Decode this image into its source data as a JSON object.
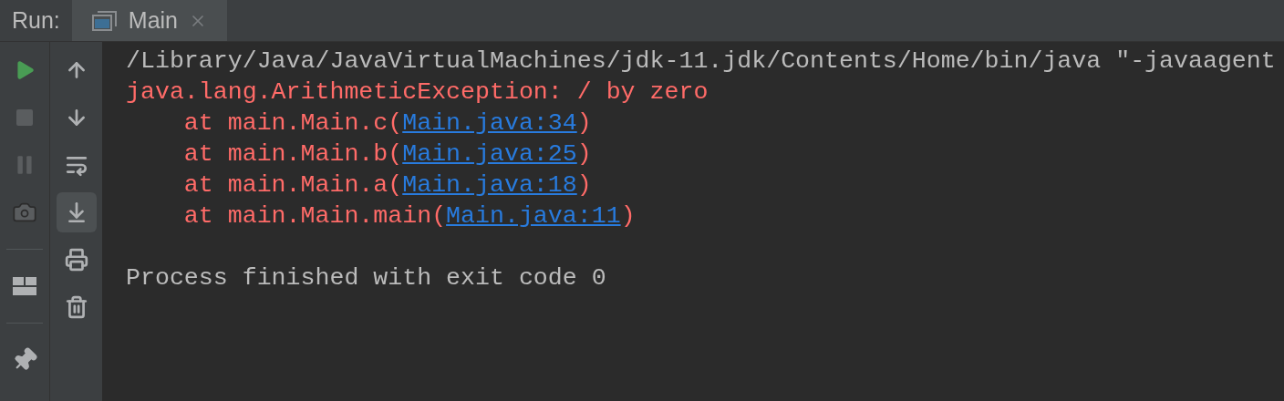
{
  "run_label": "Run:",
  "tabs": [
    {
      "label": "Main",
      "selected": true,
      "closable": true
    }
  ],
  "toolbar_left": [
    {
      "kind": "run",
      "disabled": false
    },
    {
      "kind": "stop",
      "disabled": true
    },
    {
      "kind": "pause",
      "disabled": true
    },
    {
      "kind": "camera",
      "disabled": true
    },
    {
      "kind": "separator"
    },
    {
      "kind": "layout",
      "disabled": false
    },
    {
      "kind": "separator"
    },
    {
      "kind": "pin",
      "disabled": false
    }
  ],
  "toolbar_right": [
    {
      "kind": "up",
      "selected": false
    },
    {
      "kind": "down",
      "selected": false
    },
    {
      "kind": "wrap",
      "selected": false
    },
    {
      "kind": "scroll-end",
      "selected": true
    },
    {
      "kind": "print",
      "selected": false
    },
    {
      "kind": "delete",
      "selected": false
    }
  ],
  "console": [
    {
      "kind": "command",
      "parts": [
        {
          "text": "/Library/Java/JavaVirtualMachines/jdk-11.jdk/Contents/Home/bin/java \"-javaagent",
          "link": false
        }
      ]
    },
    {
      "kind": "error",
      "parts": [
        {
          "text": "java.lang.ArithmeticException: / by zero",
          "link": false
        }
      ]
    },
    {
      "kind": "error",
      "parts": [
        {
          "text": "    at main.Main.c(",
          "link": false
        },
        {
          "text": "Main.java:34",
          "link": true
        },
        {
          "text": ")",
          "link": false
        }
      ]
    },
    {
      "kind": "error",
      "parts": [
        {
          "text": "    at main.Main.b(",
          "link": false
        },
        {
          "text": "Main.java:25",
          "link": true
        },
        {
          "text": ")",
          "link": false
        }
      ]
    },
    {
      "kind": "error",
      "parts": [
        {
          "text": "    at main.Main.a(",
          "link": false
        },
        {
          "text": "Main.java:18",
          "link": true
        },
        {
          "text": ")",
          "link": false
        }
      ]
    },
    {
      "kind": "error",
      "parts": [
        {
          "text": "    at main.Main.main(",
          "link": false
        },
        {
          "text": "Main.java:11",
          "link": true
        },
        {
          "text": ")",
          "link": false
        }
      ]
    },
    {
      "kind": "blank"
    },
    {
      "kind": "info",
      "parts": [
        {
          "text": "Process finished with exit code 0",
          "link": false
        }
      ]
    }
  ]
}
